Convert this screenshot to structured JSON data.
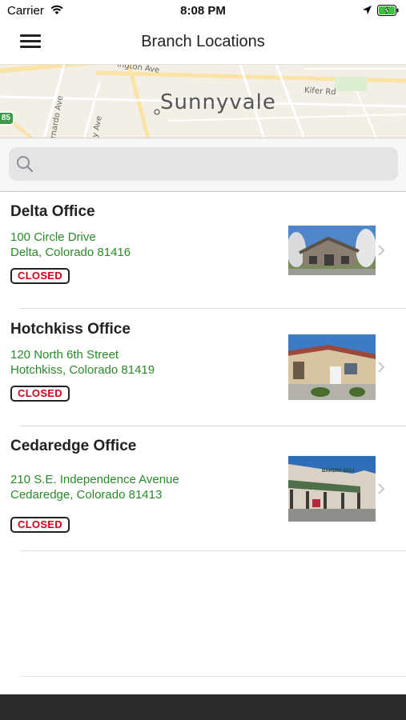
{
  "status_bar": {
    "carrier": "Carrier",
    "time": "8:08 PM",
    "icons": [
      "wifi-icon",
      "location-arrow-icon",
      "battery-charging-icon"
    ]
  },
  "nav": {
    "title": "Branch Locations",
    "menu_icon": "hamburger-menu-icon"
  },
  "map": {
    "city_label": "Sunnyvale",
    "street_labels": [
      "ington Ave",
      "Kifer Rd",
      "rnardo Ave",
      "y Ave"
    ],
    "highway_shield": "85"
  },
  "search": {
    "placeholder": "",
    "value": "",
    "icon": "search-icon"
  },
  "branches": [
    {
      "name": "Delta Office",
      "address_line1": "100 Circle Drive",
      "address_line2": "Delta, Colorado 81416",
      "status": "CLOSED"
    },
    {
      "name": "Hotchkiss Office",
      "address_line1": "120 North 6th Street",
      "address_line2": "Hotchkiss, Colorado 81419",
      "status": "CLOSED"
    },
    {
      "name": "Cedaredge Office",
      "address_line1": "210 S.E. Independence Avenue",
      "address_line2": "Cedaredge, Colorado 81413",
      "status": "CLOSED",
      "photo_sign": "BAKERY DELI"
    }
  ],
  "colors": {
    "address_green": "#2a8a2a",
    "closed_red": "#d0021b",
    "map_background": "#f3efe6",
    "bottom_bar": "#2b2b2b"
  }
}
